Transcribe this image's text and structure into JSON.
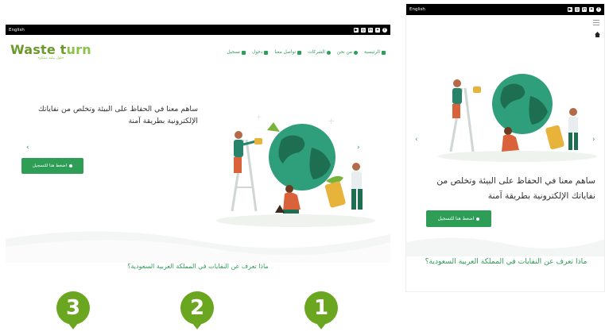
{
  "desktop": {
    "lang_link": "English",
    "logo": {
      "text_a": "Waste t",
      "text_b": "urn",
      "tagline": "حلول بيئية مبتكرة"
    },
    "menu": [
      {
        "label": "الرئيسية",
        "icon": "home-icon"
      },
      {
        "label": "من نحن",
        "icon": "info-icon"
      },
      {
        "label": "الشركات",
        "icon": "globe-icon"
      },
      {
        "label": "تواصل معنا",
        "icon": "envelope-icon"
      },
      {
        "label": "دخول",
        "icon": "login-icon"
      },
      {
        "label": "تسجيل",
        "icon": "plus-icon"
      }
    ],
    "hero": {
      "headline": "ساهم معنا في الحفاظ على البيئة وتخلص من نفاياتك الإلكترونية بطريقة آمنة",
      "cta": "اضغط هنا للتسجيل"
    },
    "section_title": "ماذا تعرف عن النفايات في المملكة العربية السعودية؟",
    "numbers": [
      "3",
      "2",
      "1"
    ]
  },
  "mobile": {
    "lang_link": "English",
    "hero": {
      "headline": "ساهم معنا في الحفاظ على البيئة وتخلص من نفاياتك الإلكترونية بطريقة آمنة",
      "cta": "اضغط هنا للتسجيل"
    },
    "section_title": "ماذا تعرف عن النفايات في المملكة العربية السعودية؟"
  },
  "colors": {
    "brand_green": "#2e9e57",
    "leaf_green": "#6aa61f",
    "topbar": "#000000"
  }
}
